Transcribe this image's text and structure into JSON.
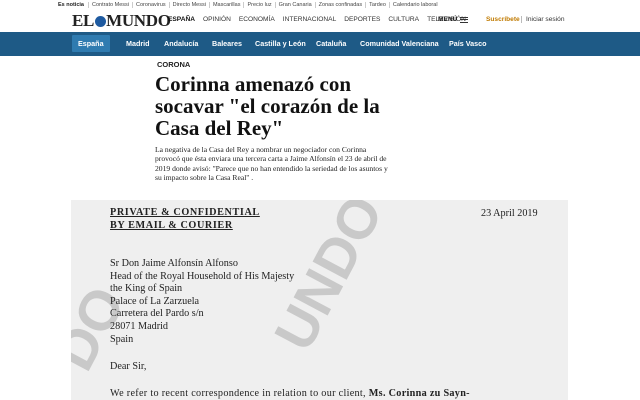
{
  "topstrip": {
    "edition": "Es noticia",
    "items": [
      "Contrato Messi",
      "Coronavirus",
      "Directo Messi",
      "Mascarillas",
      "Precio luz",
      "Gran Canaria",
      "Zonas confinadas",
      "Tardeo",
      "Calendario laboral"
    ]
  },
  "header": {
    "logo_left": "EL",
    "logo_right": "MUNDO",
    "nav": [
      "ESPAÑA",
      "OPINIÓN",
      "ECONOMÍA",
      "INTERNACIONAL",
      "DEPORTES",
      "CULTURA",
      "TELEVISIÓN"
    ],
    "active_nav": "ESPAÑA",
    "menu_label": "MENÚ",
    "subscribe": "Suscríbete",
    "signin": "Iniciar sesión",
    "logo_color": "#1e5aa0",
    "subscribe_color": "#c07a00"
  },
  "regions": {
    "selected": "España",
    "items": [
      "Madrid",
      "Andalucía",
      "Baleares",
      "Castilla y León",
      "Cataluña",
      "Comunidad Valenciana",
      "País Vasco"
    ],
    "bar_color": "#1e5a86"
  },
  "article": {
    "kicker": "CORONA",
    "headline": "Corinna amenazó con socavar \"el corazón de la Casa del Rey\"",
    "deck": "La negativa de la Casa del Rey a nombrar un negociador con Corinna provocó que ésta enviara una tercera carta a Jaime Alfonsín el 23 de abril de 2019 donde avisó: \"Parece que no han entendido la seriedad de los asuntos y su impacto sobre la Casa Real\" ."
  },
  "letter": {
    "confidential_line1": "PRIVATE & CONFIDENTIAL",
    "confidential_line2": "BY EMAIL & COURIER",
    "date": "23 April 2019",
    "address": [
      "Sr Don Jaime Alfonsín Alfonso",
      "Head of the Royal Household of His Majesty",
      "the King of Spain",
      "Palace of La Zarzuela",
      "Carretera del Pardo s/n",
      "28071 Madrid",
      "Spain"
    ],
    "salutation": "Dear Sir,",
    "body_start": "We refer to recent correspondence in relation to our client, ",
    "body_bold": "Ms. Corinna zu Sayn-",
    "watermark_left": "DO",
    "watermark_right": "UNDO"
  }
}
